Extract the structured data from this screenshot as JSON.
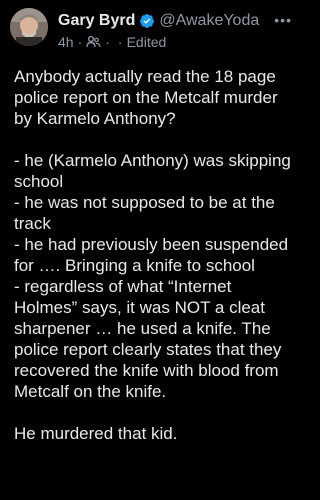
{
  "post": {
    "author": {
      "display_name": "Gary Byrd",
      "handle": "@AwakeYoda",
      "verified": true,
      "verified_color": "#1d9bf0"
    },
    "time": "4h",
    "status": "Edited",
    "more_icon": "more-horizontal-icon",
    "privacy_icon": "people-audience-icon",
    "paragraphs": [
      "Anybody actually read the 18 page police report on the Metcalf murder by Karmelo Anthony?",
      "- he (Karmelo Anthony) was skipping school\n- he was not supposed to be at the track\n- he had previously been suspended for …. Bringing a knife to school\n- regardless of what “Internet Holmes” says, it was NOT a cleat sharpener … he used a knife. The police report clearly states that they recovered the knife with blood from Metcalf on the knife.",
      "He murdered that kid."
    ]
  }
}
